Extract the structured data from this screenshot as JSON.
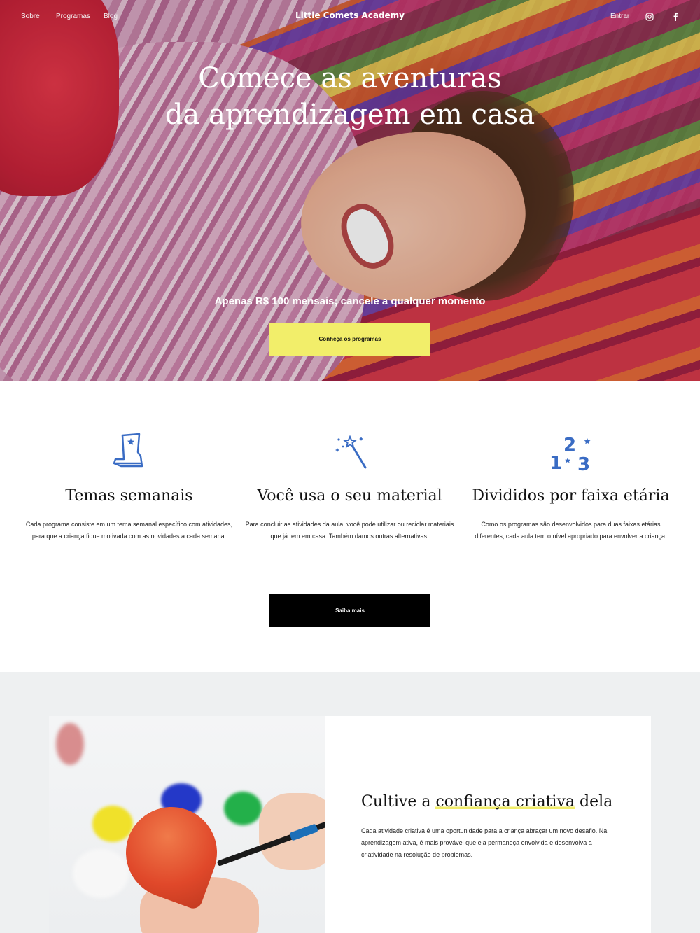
{
  "nav": {
    "links": [
      "Sobre",
      "Programas",
      "Blog"
    ],
    "brand": "Little Comets Academy",
    "login": "Entrar",
    "social_icons": [
      "instagram-icon",
      "facebook-icon"
    ]
  },
  "hero": {
    "title_line1": "Comece as aventuras",
    "title_line2": "da aprendizagem em casa",
    "subtitle": "Apenas R$ 100 mensais; cancele a qualquer momento",
    "cta": "Conheça os programas"
  },
  "features": [
    {
      "icon": "boot-icon",
      "title": "Temas semanais",
      "text": "Cada programa consiste em um tema semanal específico com atividades, para que a criança fique motivada com as novidades a cada semana."
    },
    {
      "icon": "magic-wand-icon",
      "title": "Você usa o seu material",
      "text": "Para concluir as atividades da aula, você pode utilizar ou reciclar materiais que já tem em casa. Também damos outras alternativas."
    },
    {
      "icon": "numbers-icon",
      "title": "Divididos por faixa etária",
      "text": "Como os programas são desenvolvidos para duas faixas etárias diferentes, cada aula tem o nível apropriado para envolver a criança."
    }
  ],
  "learn_more": "Saiba mais",
  "creative": {
    "title_before": "Cultive a ",
    "title_highlight": "confiança criativa",
    "title_after": " dela",
    "text": "Cada atividade criativa é uma oportunidade para a criança abraçar um novo desafio. Na aprendizagem ativa, é mais provável que ela permaneça envolvida e desenvolva a criatividade na resolução de problemas."
  },
  "colors": {
    "accent_yellow": "#f2ee6a",
    "icon_blue": "#3a6cc4",
    "grey_bg": "#eef0f1"
  }
}
